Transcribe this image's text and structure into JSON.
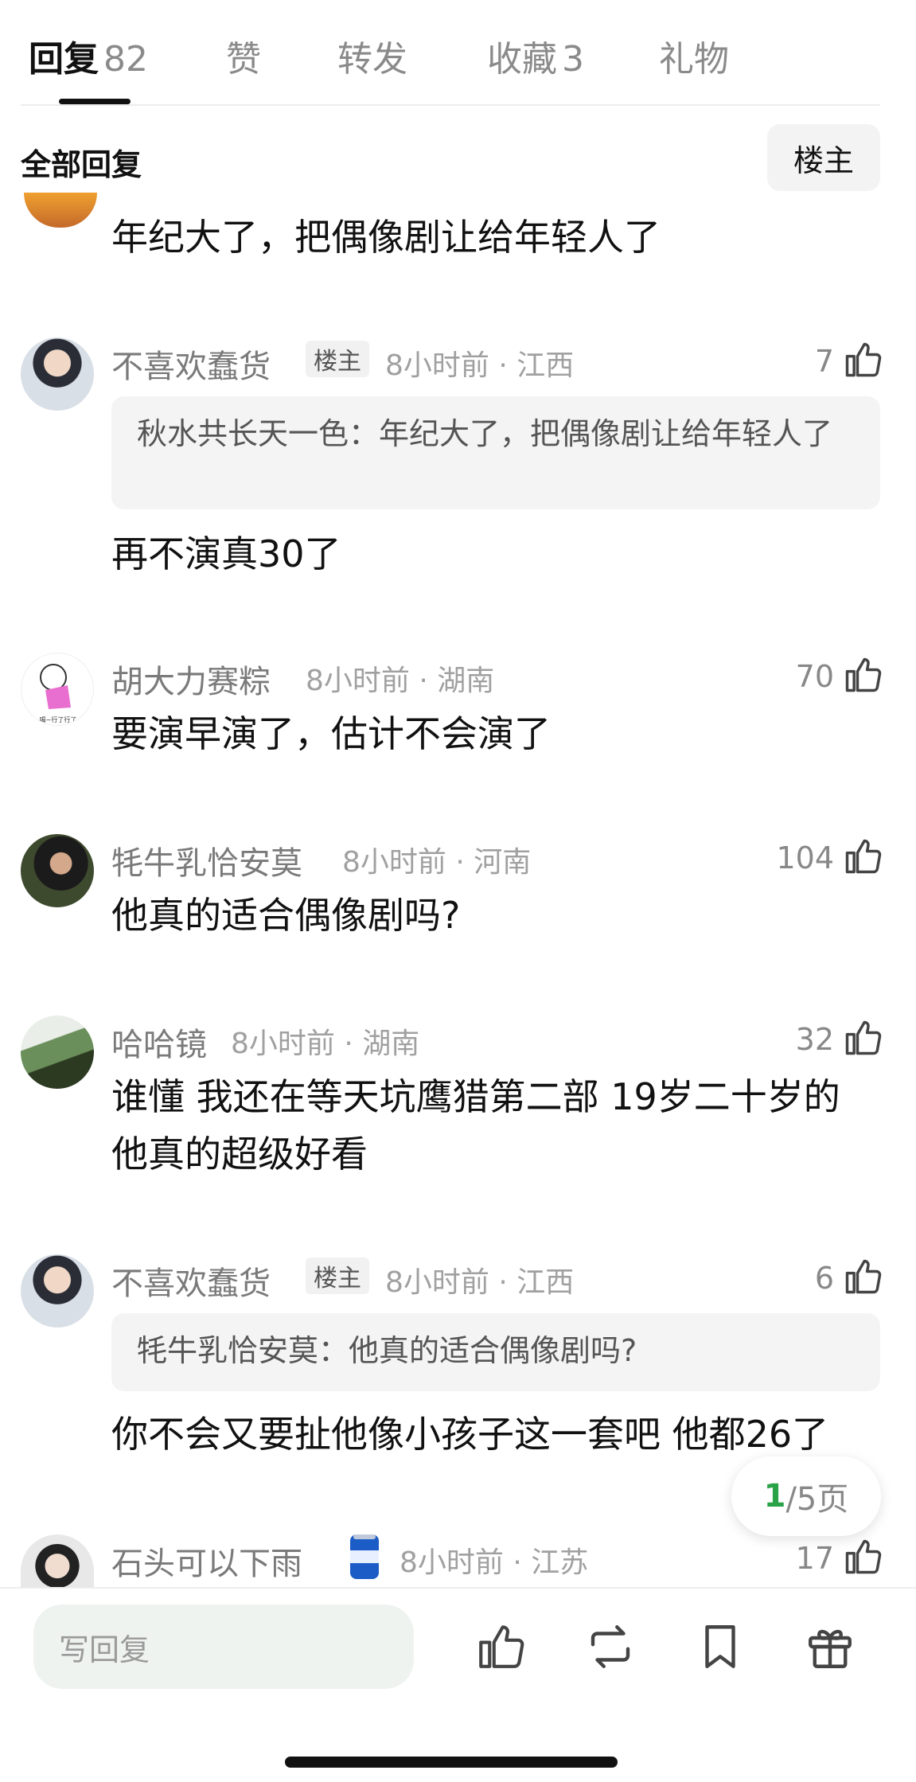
{
  "tabs": [
    {
      "label": "回复",
      "count": "82"
    },
    {
      "label": "赞"
    },
    {
      "label": "转发"
    },
    {
      "label": "收藏",
      "count": "3"
    },
    {
      "label": "礼物"
    }
  ],
  "section": {
    "title": "全部回复",
    "filter_label": "楼主"
  },
  "comments": [
    {
      "text": "年纪大了，把偶像剧让给年轻人了"
    },
    {
      "name": "不喜欢蠢货",
      "badge": "楼主",
      "meta": "8小时前 · 江西",
      "likes": "7",
      "quote": "秋水共长天一色：年纪大了，把偶像剧让给年轻人了",
      "text": "再不演真30了"
    },
    {
      "name": "胡大力赛粽",
      "meta": "8小时前 · 湖南",
      "likes": "70",
      "text": "要演早演了，估计不会演了",
      "avatar_caption": "喝~行了行了"
    },
    {
      "name": "牦牛乳恰安莫",
      "meta": "8小时前 · 河南",
      "likes": "104",
      "text": "他真的适合偶像剧吗?"
    },
    {
      "name": "哈哈镜",
      "meta": "8小时前 · 湖南",
      "likes": "32",
      "text_lines": [
        "谁懂 我还在等天坑鹰猎第二部 19岁二十岁的",
        "他真的超级好看"
      ]
    },
    {
      "name": "不喜欢蠢货",
      "badge": "楼主",
      "meta": "8小时前 · 江西",
      "likes": "6",
      "quote": "牦牛乳恰安莫：他真的适合偶像剧吗?",
      "text": "你不会又要扯他像小孩子这一套吧 他都26了"
    },
    {
      "name": "石头可以下雨",
      "meta": "8小时前 · 江苏",
      "likes": "17"
    }
  ],
  "pager": {
    "current": "1",
    "total_suffix": "/5页"
  },
  "bottom": {
    "reply_placeholder": "写回复"
  },
  "icons": {
    "like": "thumbs-up-icon",
    "repost": "repost-icon",
    "bookmark": "bookmark-icon",
    "gift": "gift-icon"
  },
  "colors": {
    "accent_green": "#2aa248",
    "text_secondary": "#7a7a7a"
  }
}
